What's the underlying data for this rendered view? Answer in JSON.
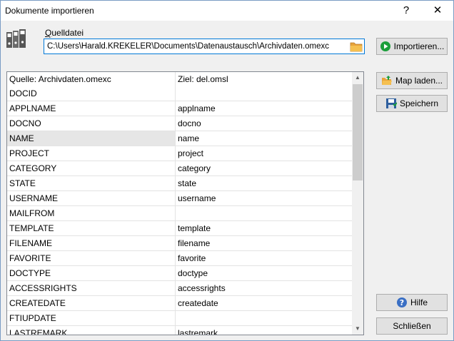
{
  "window": {
    "title": "Dokumente importieren",
    "help_glyph": "?",
    "close_glyph": "✕"
  },
  "source": {
    "label": "Quelldatei",
    "path": "C:\\Users\\Harald.KREKELER\\Documents\\Datenaustausch\\Archivdaten.omexc"
  },
  "buttons": {
    "import": "Importieren...",
    "map_load": "Map laden...",
    "save": "Speichern",
    "help": "Hilfe",
    "close": "Schließen"
  },
  "grid": {
    "col1_header": "Quelle: Archivdaten.omexc",
    "col2_header": "Ziel: del.omsl",
    "rows": [
      {
        "source": "DOCID",
        "target": ""
      },
      {
        "source": "APPLNAME",
        "target": "applname"
      },
      {
        "source": "DOCNO",
        "target": "docno"
      },
      {
        "source": "NAME",
        "target": "name"
      },
      {
        "source": "PROJECT",
        "target": "project"
      },
      {
        "source": "CATEGORY",
        "target": "category"
      },
      {
        "source": "STATE",
        "target": "state"
      },
      {
        "source": "USERNAME",
        "target": "username"
      },
      {
        "source": "MAILFROM",
        "target": ""
      },
      {
        "source": "TEMPLATE",
        "target": "template"
      },
      {
        "source": "FILENAME",
        "target": "filename"
      },
      {
        "source": "FAVORITE",
        "target": "favorite"
      },
      {
        "source": "DOCTYPE",
        "target": "doctype"
      },
      {
        "source": "ACCESSRIGHTS",
        "target": "accessrights"
      },
      {
        "source": "CREATEDATE",
        "target": "createdate"
      },
      {
        "source": "FTIUPDATE",
        "target": ""
      },
      {
        "source": "LASTREMARK",
        "target": "lastremark"
      }
    ]
  },
  "colors": {
    "accent": "#0078d7",
    "import_icon": "#1a9e3a",
    "help_icon": "#3a6fc4",
    "folder_icon": "#e8a33a"
  },
  "icons": {
    "app": "binders-icon",
    "folder": "folder-icon",
    "import": "play-icon",
    "map": "folder-open-icon",
    "save": "floppy-icon",
    "help": "question-icon"
  }
}
